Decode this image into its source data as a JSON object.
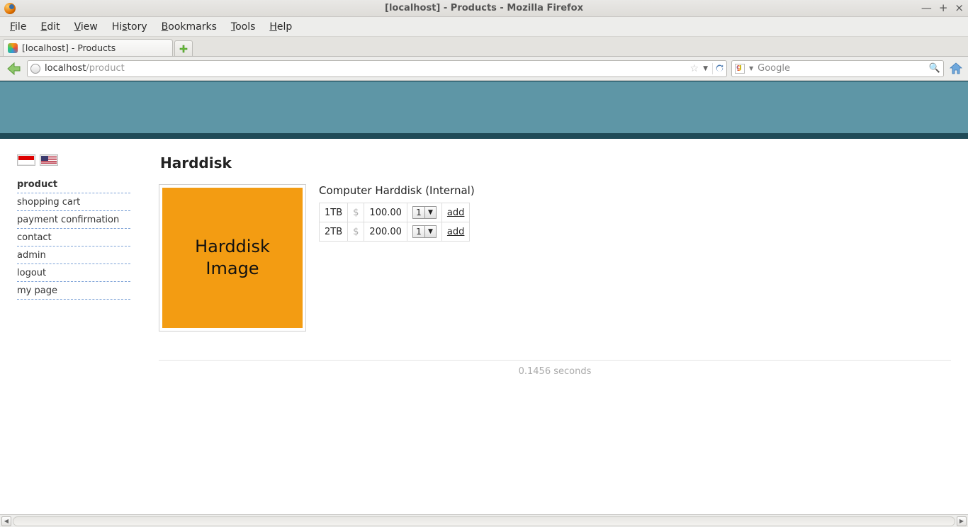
{
  "window": {
    "title": "[localhost] - Products - Mozilla Firefox"
  },
  "menubar": {
    "file": "File",
    "edit": "Edit",
    "view": "View",
    "history": "History",
    "bookmarks": "Bookmarks",
    "tools": "Tools",
    "help": "Help"
  },
  "tab": {
    "label": "[localhost] - Products"
  },
  "urlbar": {
    "host": "localhost",
    "path": "/product"
  },
  "searchbar": {
    "placeholder": "Google"
  },
  "sidebar": {
    "items": [
      {
        "label": "product",
        "active": true
      },
      {
        "label": "shopping cart"
      },
      {
        "label": "payment confirmation"
      },
      {
        "label": "contact"
      },
      {
        "label": "admin"
      },
      {
        "label": "logout"
      },
      {
        "label": "my page"
      }
    ]
  },
  "product": {
    "title": "Harddisk",
    "image_placeholder_line1": "Harddisk",
    "image_placeholder_line2": "Image",
    "description": "Computer Harddisk (Internal)",
    "currency": "$",
    "add_label": "add",
    "variants": [
      {
        "size": "1TB",
        "price": "100.00",
        "qty": "1"
      },
      {
        "size": "2TB",
        "price": "200.00",
        "qty": "1"
      }
    ]
  },
  "footer": {
    "load_time": "0.1456 seconds"
  }
}
